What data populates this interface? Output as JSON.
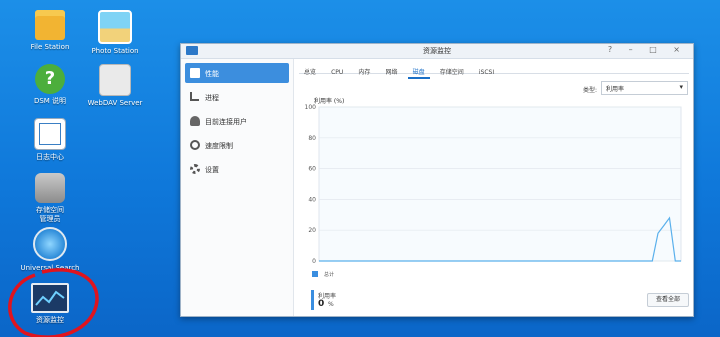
{
  "desktop": {
    "icons": [
      {
        "label": "File Station"
      },
      {
        "label": "Photo Station"
      },
      {
        "label": "DSM 说明"
      },
      {
        "label": "WebDAV Server"
      },
      {
        "label": "日志中心"
      },
      {
        "label": "存储空间\n管理员"
      },
      {
        "label": "Universal Search"
      },
      {
        "label": "资源监控"
      }
    ]
  },
  "window": {
    "title": "资源监控",
    "controls": "? – □ ×",
    "sidebar": [
      {
        "label": "性能",
        "icon": "performance-icon",
        "active": true
      },
      {
        "label": "进程",
        "icon": "process-icon"
      },
      {
        "label": "目前连接用户",
        "icon": "users-icon"
      },
      {
        "label": "速度限制",
        "icon": "speed-limit-icon"
      },
      {
        "label": "设置",
        "icon": "gear-icon"
      }
    ],
    "tabs": [
      "总览",
      "CPU",
      "内存",
      "网络",
      "磁盘",
      "存储空间",
      "iSCSI"
    ],
    "active_tab": "磁盘",
    "type_label": "类型:",
    "type_value": "利用率",
    "chart_title": "利用率 (%)",
    "legend": "总计",
    "util_label": "利用率",
    "util_value": "0",
    "util_unit": "%",
    "view_all": "查看全部"
  },
  "chart_data": {
    "type": "line",
    "title": "利用率 (%)",
    "ylim": [
      0,
      100
    ],
    "yticks": [
      "0",
      "20",
      "40",
      "60",
      "80",
      "100"
    ],
    "grid": true,
    "series": [
      {
        "name": "总计",
        "values": [
          0,
          0,
          0,
          0,
          0,
          0,
          0,
          0,
          0,
          0,
          0,
          0,
          0,
          0,
          0,
          0,
          0,
          0,
          0,
          0,
          0,
          0,
          0,
          0,
          0,
          0,
          0,
          0,
          0,
          0,
          0,
          0,
          0,
          0,
          0,
          0,
          0,
          0,
          0,
          0,
          0,
          0,
          0,
          0,
          0,
          0,
          0,
          0,
          0,
          0,
          0,
          0,
          0,
          0,
          0,
          0,
          0,
          0,
          0,
          18,
          23,
          28,
          0,
          0
        ]
      }
    ],
    "color": "#5ab0ec"
  }
}
